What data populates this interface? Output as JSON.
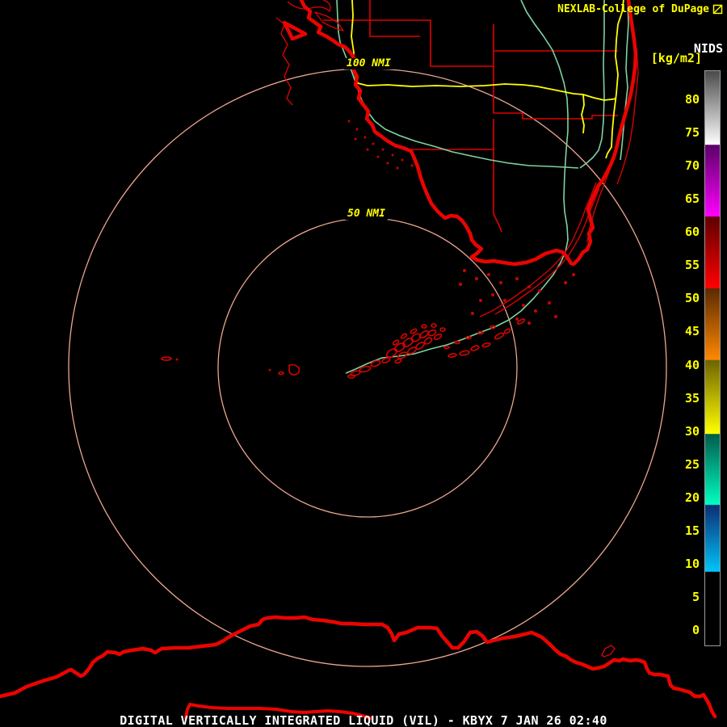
{
  "header": {
    "brand": "NEXLAB-College of DuPage"
  },
  "legend": {
    "product": "NIDS",
    "units": "[kg/m2]",
    "ticks": [
      "80",
      "75",
      "70",
      "65",
      "60",
      "55",
      "50",
      "45",
      "40",
      "35",
      "30",
      "25",
      "20",
      "15",
      "10",
      "5",
      "0"
    ]
  },
  "rings": {
    "outer_label": "100 NMI",
    "inner_label": "50 NMI"
  },
  "footer": {
    "title": "DIGITAL VERTICALLY INTEGRATED LIQUID (VIL) - KBYX 7 JAN 26 02:40"
  },
  "colors": {
    "background": "#000000",
    "coastline_red": "#ea0400",
    "county_red": "#e00000",
    "highway_yellow": "#ffff00",
    "road_green": "#7fd3a0",
    "range_ring_salmon": "#eda691",
    "label_yellow": "#ffff00",
    "label_white": "#ffffff"
  }
}
